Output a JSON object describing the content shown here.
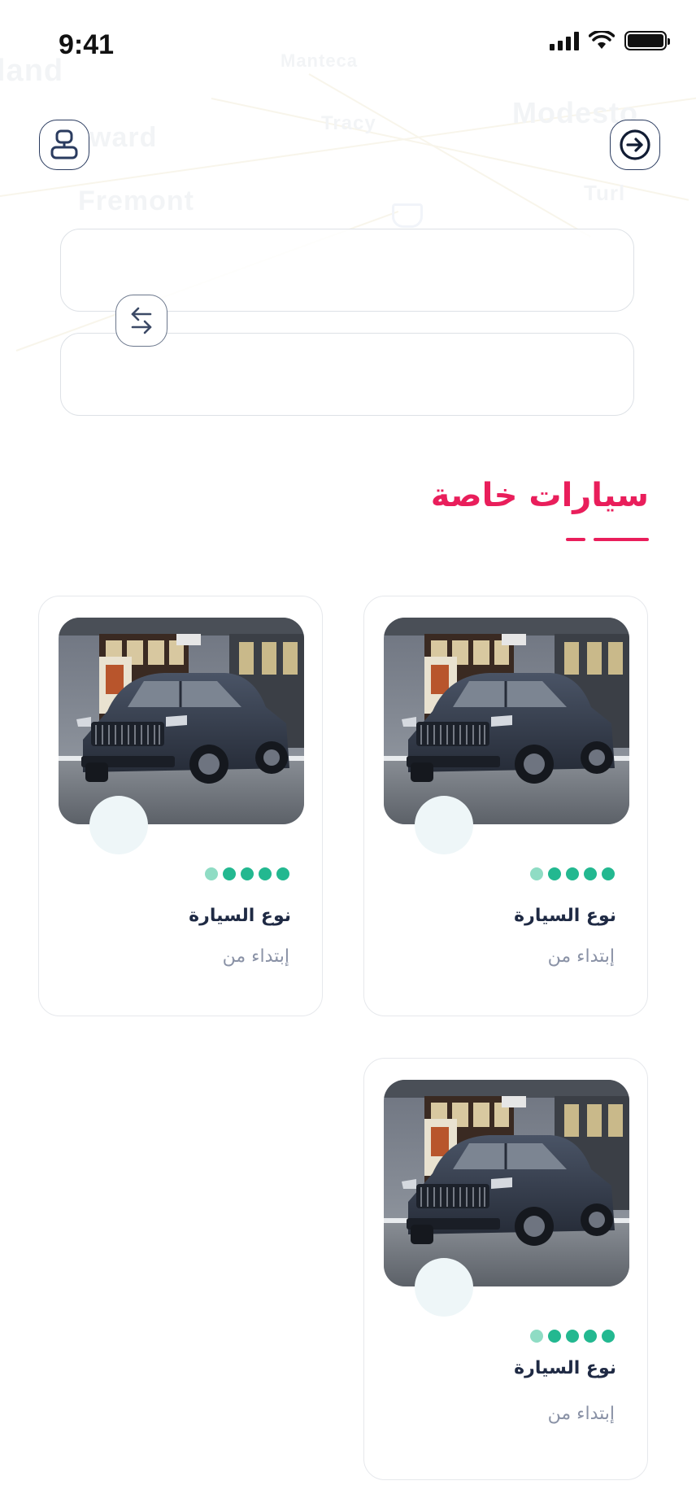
{
  "status_bar": {
    "time": "9:41"
  },
  "map_labels": [
    "Manteca",
    "Tracy",
    "Modesto",
    "Turl",
    "ward",
    "Fremont",
    "land"
  ],
  "header": {
    "left_icon": "profile-icon",
    "right_icon": "arrow-right-circle-icon"
  },
  "route": {
    "from_value": "",
    "to_value": "",
    "swap_icon": "swap-arrows-icon"
  },
  "section": {
    "title": "سيارات خاصة",
    "accent_color": "#e91e5b"
  },
  "cars": [
    {
      "type_label": "نوع السيارة",
      "price_label": "إبتداء من",
      "rating": 5
    },
    {
      "type_label": "نوع السيارة",
      "price_label": "إبتداء من",
      "rating": 5
    },
    {
      "type_label": "نوع السيارة",
      "price_label": "إبتداء من",
      "rating": 5
    }
  ],
  "colors": {
    "rating_dot": "#23b890",
    "rating_dot_first": "#8fdcc4",
    "text_primary": "#1f2a44",
    "text_secondary": "#8a92a6"
  }
}
